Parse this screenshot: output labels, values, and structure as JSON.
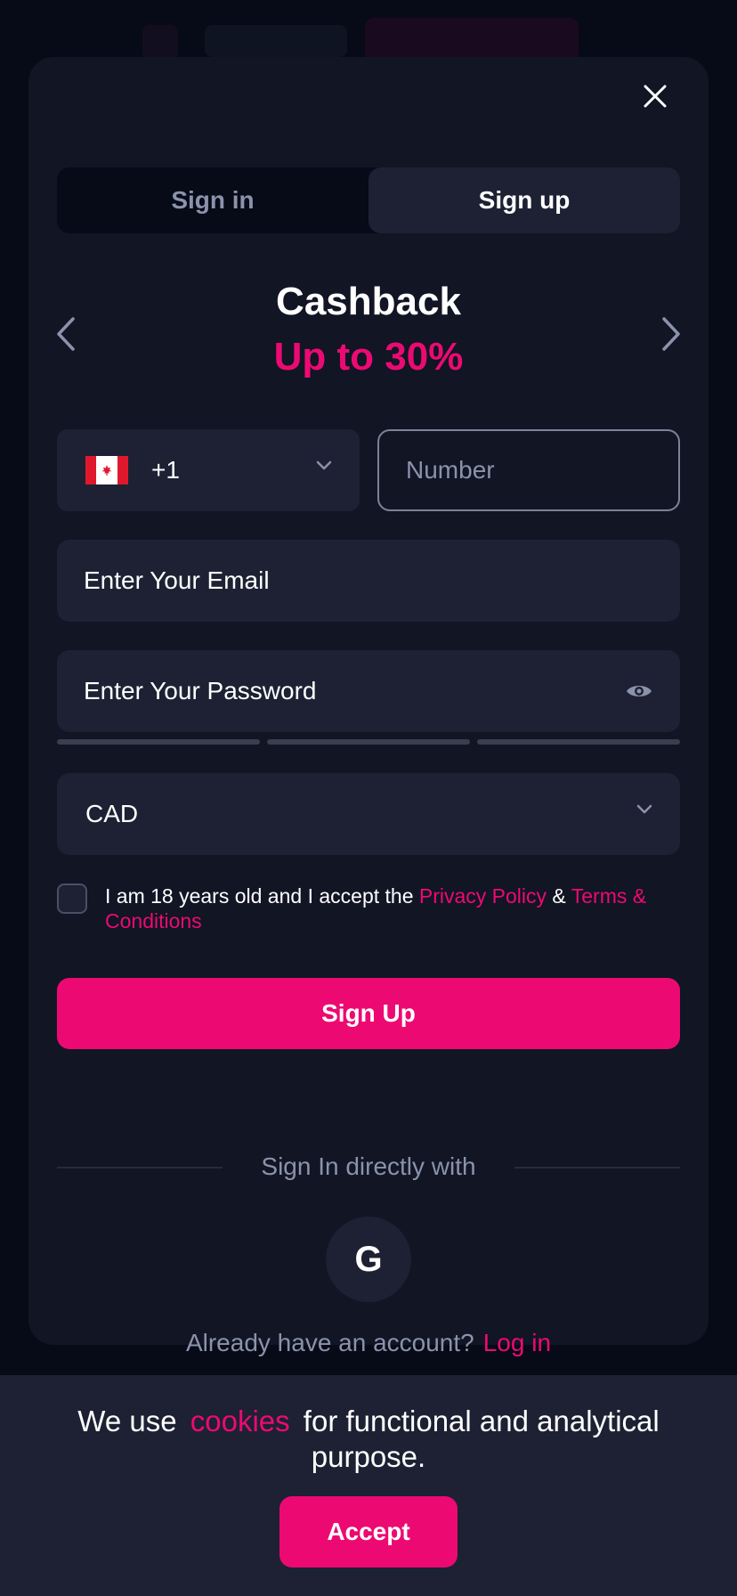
{
  "colors": {
    "accent": "#ec0a72",
    "modal_bg": "#111524",
    "field_bg": "#1d2133",
    "muted_text": "#8a93ab"
  },
  "modal": {
    "close_icon": "close-icon",
    "tabs": [
      {
        "label": "Sign in",
        "active": false
      },
      {
        "label": "Sign up",
        "active": true
      }
    ],
    "promo": {
      "title": "Cashback",
      "subtitle": "Up to 30%",
      "prev_icon": "chevron-left-icon",
      "next_icon": "chevron-right-icon"
    },
    "phone": {
      "country_flag": "canada-flag-icon",
      "code": "+1",
      "number_placeholder": "Number"
    },
    "email_placeholder": "Enter Your Email",
    "password_placeholder": "Enter Your Password",
    "password_toggle_icon": "eye-icon",
    "currency": "CAD",
    "terms": {
      "prefix": "I am 18 years old and I accept the ",
      "privacy_link": "Privacy Policy",
      "amp": " & ",
      "terms_link": "Terms & Conditions",
      "checked": false
    },
    "signup_button": "Sign Up",
    "social_divider": "Sign In directly with",
    "google_icon": "google-icon",
    "google_glyph": "G",
    "login_prompt": "Already have an account?",
    "login_link": "Log in"
  },
  "cookie": {
    "prefix": "We use",
    "link": "cookies",
    "suffix": "for functional and analytical purpose.",
    "accept": "Accept"
  }
}
